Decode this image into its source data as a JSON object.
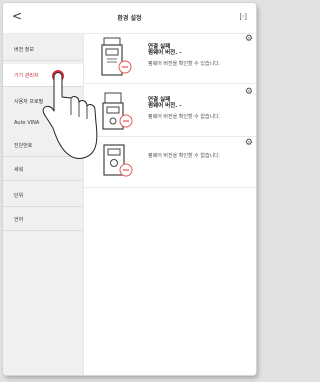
{
  "header": {
    "back_glyph": "<",
    "title": "환경 설정",
    "fit_glyph": "[◦]"
  },
  "sidebar": {
    "items": [
      {
        "label": "버전 정보"
      },
      {
        "label": "기기 관리자"
      },
      {
        "label": "사용자 프로필"
      },
      {
        "label": "Auto VINA"
      },
      {
        "label": "진단번호"
      },
      {
        "label": "세워"
      },
      {
        "label": "단위"
      },
      {
        "label": "언어"
      }
    ],
    "active_index": 1
  },
  "devices": [
    {
      "status": "연결 실패",
      "firmware": "펌웨어 버전. -",
      "note": "펌웨어 버전을 확인할 수 있습니다."
    },
    {
      "status": "연결 실패",
      "firmware": "펌웨어 버전. -",
      "note": "펌웨어 버전을 확인할 수 없습니다."
    },
    {
      "status": "",
      "firmware": "",
      "note": "펌웨어 버전을 확인할 수 없습니다."
    }
  ],
  "colors": {
    "accent": "#c62b38",
    "sidebar_bg": "#f0f0f0",
    "status_icon": "#e35b59"
  },
  "icons": [
    "back-arrow",
    "fit-screen-icon",
    "gear-icon",
    "device-icon",
    "no-connection-icon",
    "hand-pointer"
  ]
}
